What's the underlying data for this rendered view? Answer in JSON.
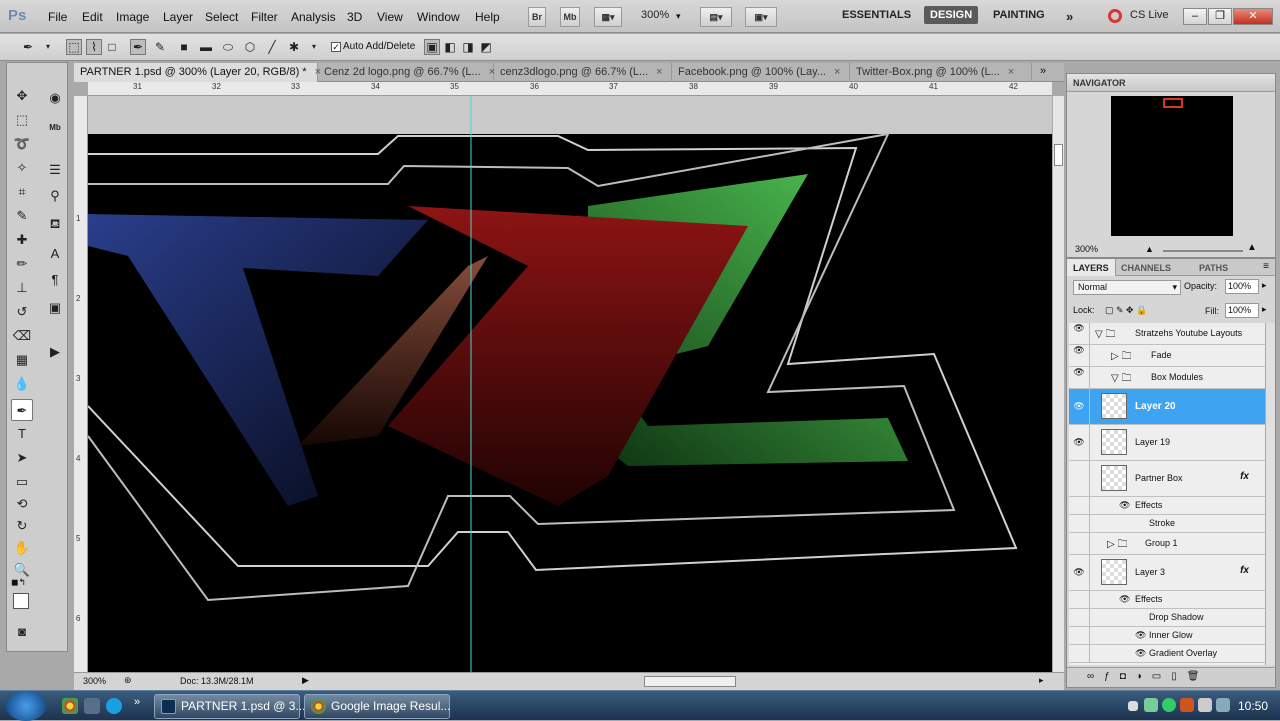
{
  "app": {
    "logo": "Ps"
  },
  "menu": [
    "File",
    "Edit",
    "Image",
    "Layer",
    "Select",
    "Filter",
    "Analysis",
    "3D",
    "View",
    "Window",
    "Help"
  ],
  "appbar": {
    "br_label": "Br",
    "mb_label": "Mb",
    "zoom": "300%",
    "workspaces": [
      "ESSENTIALS",
      "DESIGN",
      "PAINTING"
    ],
    "active_workspace": "DESIGN",
    "cslive": "CS Live"
  },
  "options": {
    "auto_add_delete": "Auto Add/Delete"
  },
  "tabs": [
    {
      "label": "PARTNER 1.psd @ 300% (Layer 20, RGB/8) *"
    },
    {
      "label": "Cenz 2d logo.png @ 66.7% (L..."
    },
    {
      "label": "cenz3dlogo.png @ 66.7% (L..."
    },
    {
      "label": "Facebook.png @ 100% (Lay..."
    },
    {
      "label": "Twitter-Box.png @ 100% (L..."
    }
  ],
  "ruler": {
    "h": [
      "31",
      "32",
      "33",
      "34",
      "35",
      "36",
      "37",
      "38",
      "39",
      "40",
      "41",
      "42"
    ],
    "v": [
      "1",
      "2",
      "3",
      "4",
      "5",
      "6"
    ]
  },
  "status": {
    "zoom": "300%",
    "doc": "Doc: 13.3M/28.1M"
  },
  "navigator": {
    "title": "NAVIGATOR",
    "zoom": "300%"
  },
  "layers_panel": {
    "tabs": [
      "LAYERS",
      "CHANNELS",
      "PATHS"
    ],
    "blend_mode": "Normal",
    "opacity_label": "Opacity:",
    "opacity": "100%",
    "lock_label": "Lock:",
    "fill_label": "Fill:",
    "fill": "100%",
    "rows": [
      {
        "name": "Stratzehs Youtube Layouts",
        "kind": "group"
      },
      {
        "name": "Fade",
        "kind": "group"
      },
      {
        "name": "Box Modules",
        "kind": "group"
      },
      {
        "name": "Layer 20",
        "kind": "layer",
        "selected": true
      },
      {
        "name": "Layer 19",
        "kind": "layer"
      },
      {
        "name": "Partner Box",
        "kind": "layer",
        "fx": "fx"
      },
      {
        "name": "Effects",
        "kind": "effects"
      },
      {
        "name": "Stroke",
        "kind": "effect"
      },
      {
        "name": "Group 1",
        "kind": "group"
      },
      {
        "name": "Layer 3",
        "kind": "layer",
        "fx": "fx"
      },
      {
        "name": "Effects",
        "kind": "effects"
      },
      {
        "name": "Drop Shadow",
        "kind": "effect"
      },
      {
        "name": "Inner Glow",
        "kind": "effect"
      },
      {
        "name": "Gradient Overlay",
        "kind": "effect"
      }
    ]
  },
  "taskbar": {
    "items": [
      "PARTNER 1.psd @ 3...",
      "Google Image Resul..."
    ],
    "clock": "10:50"
  },
  "colors": {
    "selection": "#3ea3f0",
    "canvas_bg": "#000000",
    "blue": "#1d2f6b",
    "red": "#7a1010",
    "green": "#49d04f"
  }
}
